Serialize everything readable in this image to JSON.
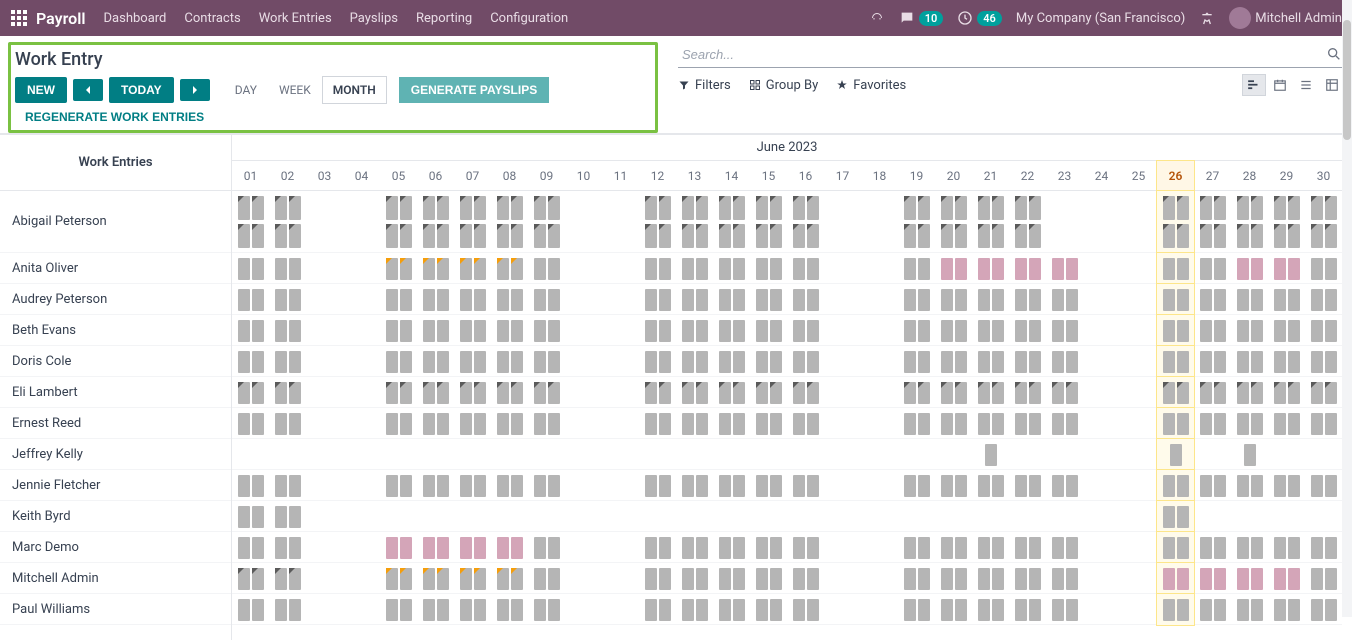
{
  "nav": {
    "brand": "Payroll",
    "items": [
      "Dashboard",
      "Contracts",
      "Work Entries",
      "Payslips",
      "Reporting",
      "Configuration"
    ],
    "chat_count": "10",
    "clock_count": "46",
    "company": "My Company (San Francisco)",
    "user": "Mitchell Admin"
  },
  "controls": {
    "title": "Work Entry",
    "new": "NEW",
    "today": "TODAY",
    "day": "DAY",
    "week": "WEEK",
    "month": "MONTH",
    "gen": "GENERATE PAYSLIPS",
    "regen": "REGENERATE WORK ENTRIES"
  },
  "search": {
    "placeholder": "Search...",
    "filters": "Filters",
    "groupby": "Group By",
    "favorites": "Favorites"
  },
  "grid": {
    "side_header": "Work Entries",
    "month_label": "June 2023",
    "days": [
      "01",
      "02",
      "03",
      "04",
      "05",
      "06",
      "07",
      "08",
      "09",
      "10",
      "11",
      "12",
      "13",
      "14",
      "15",
      "16",
      "17",
      "18",
      "19",
      "20",
      "21",
      "22",
      "23",
      "24",
      "25",
      "26",
      "27",
      "28",
      "29",
      "30"
    ],
    "today_index": 25,
    "weekend_indices": [
      2,
      3,
      9,
      10,
      16,
      17,
      23,
      24
    ],
    "employees": [
      {
        "name": "Abigail Peterson",
        "double_row": true,
        "style": "tri",
        "pink_days": [],
        "skip_days": [
          22
        ]
      },
      {
        "name": "Anita Oliver",
        "style": "plain",
        "tri_o_days": [
          4,
          5,
          6,
          7
        ],
        "pink_days": [
          19,
          20,
          21,
          22,
          23,
          24,
          27,
          28
        ]
      },
      {
        "name": "Audrey Peterson",
        "style": "plain"
      },
      {
        "name": "Beth Evans",
        "style": "plain"
      },
      {
        "name": "Doris Cole",
        "style": "plain"
      },
      {
        "name": "Eli Lambert",
        "style": "tri"
      },
      {
        "name": "Ernest Reed",
        "style": "plain"
      },
      {
        "name": "Jeffrey Kelly",
        "style": "plain",
        "single_block_days": [
          20,
          25,
          27
        ],
        "empty": true
      },
      {
        "name": "Jennie Fletcher",
        "style": "plain"
      },
      {
        "name": "Keith Byrd",
        "style": "plain",
        "only_days": [
          0,
          1,
          25
        ]
      },
      {
        "name": "Marc Demo",
        "style": "plain",
        "pink_days": [
          4,
          5,
          6,
          7
        ]
      },
      {
        "name": "Mitchell Admin",
        "style": "plain",
        "tri_days": [
          0,
          1
        ],
        "tri_o_days": [
          4,
          5,
          6,
          7
        ],
        "pink_days": [
          25,
          26,
          27,
          28
        ]
      },
      {
        "name": "Paul Williams",
        "style": "plain"
      }
    ]
  }
}
